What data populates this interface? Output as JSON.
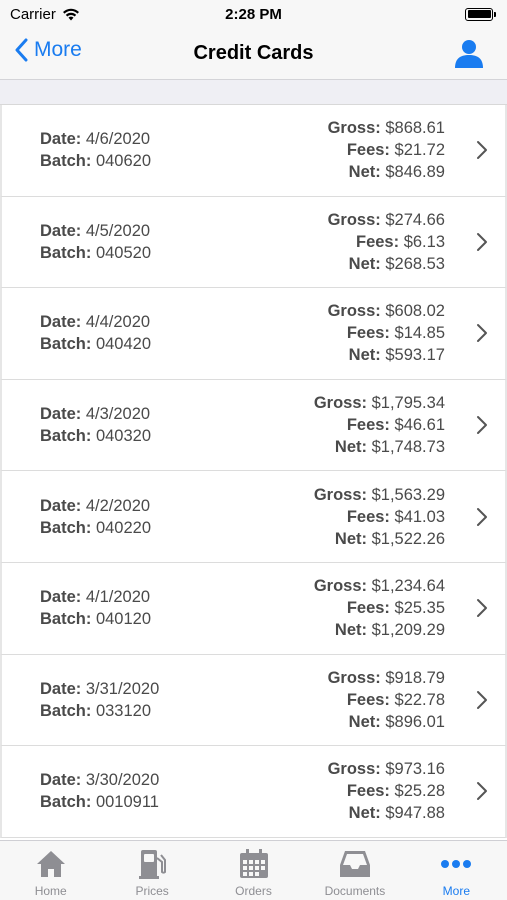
{
  "status_bar": {
    "carrier": "Carrier",
    "time": "2:28 PM"
  },
  "nav": {
    "back_label": "More",
    "title": "Credit Cards"
  },
  "labels": {
    "date": "Date:",
    "batch": "Batch:",
    "gross": "Gross:",
    "fees": "Fees:",
    "net": "Net:"
  },
  "rows": [
    {
      "date": "4/6/2020",
      "batch": "040620",
      "gross": "$868.61",
      "fees": "$21.72",
      "net": "$846.89"
    },
    {
      "date": "4/5/2020",
      "batch": "040520",
      "gross": "$274.66",
      "fees": "$6.13",
      "net": "$268.53"
    },
    {
      "date": "4/4/2020",
      "batch": "040420",
      "gross": "$608.02",
      "fees": "$14.85",
      "net": "$593.17"
    },
    {
      "date": "4/3/2020",
      "batch": "040320",
      "gross": "$1,795.34",
      "fees": "$46.61",
      "net": "$1,748.73"
    },
    {
      "date": "4/2/2020",
      "batch": "040220",
      "gross": "$1,563.29",
      "fees": "$41.03",
      "net": "$1,522.26"
    },
    {
      "date": "4/1/2020",
      "batch": "040120",
      "gross": "$1,234.64",
      "fees": "$25.35",
      "net": "$1,209.29"
    },
    {
      "date": "3/31/2020",
      "batch": "033120",
      "gross": "$918.79",
      "fees": "$22.78",
      "net": "$896.01"
    },
    {
      "date": "3/30/2020",
      "batch": "0010911",
      "gross": "$973.16",
      "fees": "$25.28",
      "net": "$947.88"
    }
  ],
  "tabs": [
    {
      "label": "Home",
      "icon": "home-icon",
      "active": false
    },
    {
      "label": "Prices",
      "icon": "gas-pump-icon",
      "active": false
    },
    {
      "label": "Orders",
      "icon": "calendar-icon",
      "active": false
    },
    {
      "label": "Documents",
      "icon": "inbox-tray-icon",
      "active": false
    },
    {
      "label": "More",
      "icon": "more-dots-icon",
      "active": true
    }
  ],
  "colors": {
    "accent": "#1a7cf0",
    "inactive_tab": "#8e8e93",
    "text": "#4a4a4a"
  }
}
